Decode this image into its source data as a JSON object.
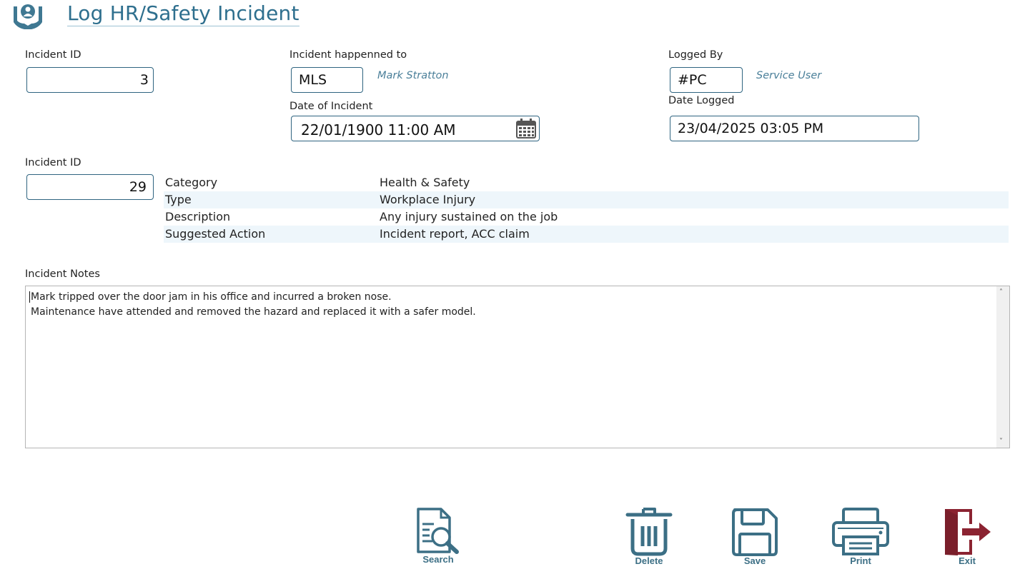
{
  "header": {
    "title": "Log HR/Safety Incident",
    "logo_icon": "hands-holding-person-icon"
  },
  "form": {
    "incident_id_label": "Incident ID",
    "incident_id_value": "3",
    "happened_to_label": "Incident happenned to",
    "happened_to_code": "MLS",
    "happened_to_name": "Mark Stratton",
    "date_incident_label": "Date of Incident",
    "date_incident_value": "22/01/1900 11:00 AM",
    "logged_by_label": "Logged By",
    "logged_by_code": "#PC",
    "logged_by_name": "Service User",
    "date_logged_label": "Date Logged",
    "date_logged_value": "23/04/2025 03:05 PM",
    "type_id_label": "Incident ID",
    "type_id_value": "29"
  },
  "details": [
    {
      "key": "Category",
      "value": "Health & Safety"
    },
    {
      "key": "Type",
      "value": "Workplace Injury"
    },
    {
      "key": "Description",
      "value": "Any injury sustained on the job"
    },
    {
      "key": "Suggested Action",
      "value": "Incident report, ACC claim"
    }
  ],
  "notes": {
    "label": "Incident Notes",
    "lines": [
      "Mark tripped over the door jam in his office and incurred a broken nose.",
      "Maintenance have attended and removed the hazard and replaced it with a safer model."
    ]
  },
  "toolbar": {
    "search": "Search",
    "delete": "Delete",
    "save": "Save",
    "print": "Print",
    "exit": "Exit"
  },
  "colors": {
    "accent": "#2e6f8e",
    "exit": "#8b2331",
    "row_alt": "#eef6fb"
  }
}
